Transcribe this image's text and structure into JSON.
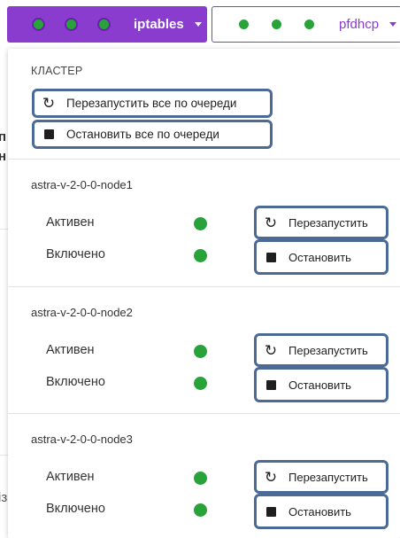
{
  "services": [
    {
      "name": "iptables",
      "active": true
    },
    {
      "name": "pfdhcp",
      "active": false
    }
  ],
  "colors": {
    "accent": "#8a3ccf",
    "status_green": "#27a33a",
    "focus_outline": "#4b6b96"
  },
  "cluster": {
    "heading": "КЛАСТЕР",
    "restart_all_label": "Перезапустить все по очереди",
    "stop_all_label": "Остановить все по очереди"
  },
  "nodes": [
    {
      "name": "astra-v-2-0-0-node1",
      "status_active": "Активен",
      "status_enabled": "Включено",
      "restart_label": "Перезапустить",
      "stop_label": "Остановить"
    },
    {
      "name": "astra-v-2-0-0-node2",
      "status_active": "Активен",
      "status_enabled": "Включено",
      "restart_label": "Перезапустить",
      "stop_label": "Остановить"
    },
    {
      "name": "astra-v-2-0-0-node3",
      "status_active": "Активен",
      "status_enabled": "Включено",
      "restart_label": "Перезапустить",
      "stop_label": "Остановить"
    }
  ],
  "icons": {
    "restart": "restart-icon",
    "stop": "stop-icon",
    "caret": "chevron-down-icon",
    "status": "status-dot-icon"
  }
}
